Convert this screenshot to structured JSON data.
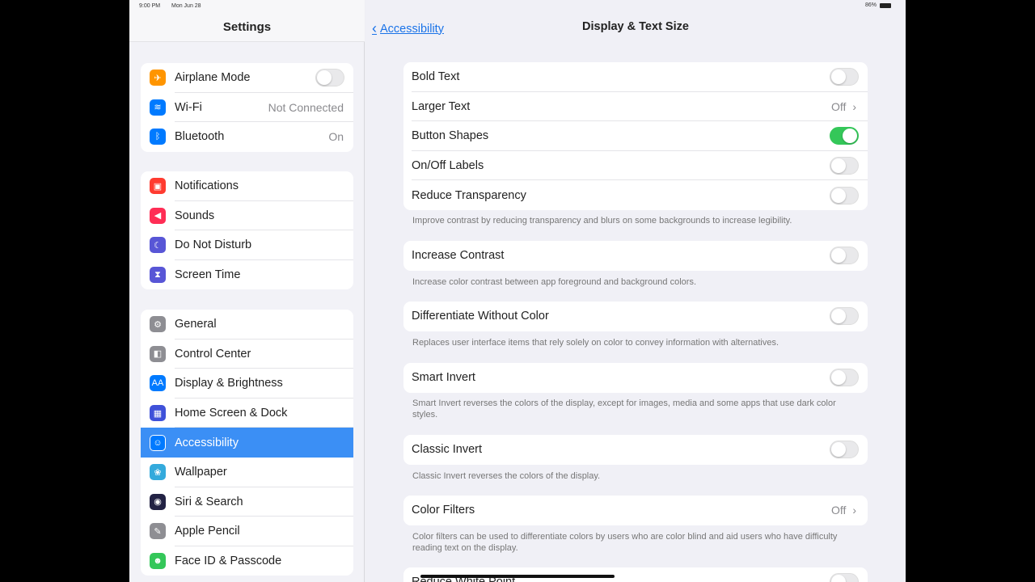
{
  "status": {
    "time": "9:00 PM",
    "date": "Mon Jun 28",
    "battery": "86%"
  },
  "sidebar": {
    "title": "Settings",
    "groups": [
      [
        {
          "label": "Airplane Mode",
          "icon": "airplane-icon",
          "color": "#ff9500",
          "toggle": false
        },
        {
          "label": "Wi-Fi",
          "icon": "wifi-icon",
          "color": "#007aff",
          "value": "Not Connected"
        },
        {
          "label": "Bluetooth",
          "icon": "bluetooth-icon",
          "color": "#007aff",
          "value": "On"
        }
      ],
      [
        {
          "label": "Notifications",
          "icon": "notifications-icon",
          "color": "#ff3b30"
        },
        {
          "label": "Sounds",
          "icon": "sounds-icon",
          "color": "#ff2d55"
        },
        {
          "label": "Do Not Disturb",
          "icon": "moon-icon",
          "color": "#5856d6"
        },
        {
          "label": "Screen Time",
          "icon": "hourglass-icon",
          "color": "#5856d6"
        }
      ],
      [
        {
          "label": "General",
          "icon": "gear-icon",
          "color": "#8e8e93"
        },
        {
          "label": "Control Center",
          "icon": "control-center-icon",
          "color": "#8e8e93"
        },
        {
          "label": "Display & Brightness",
          "icon": "display-icon",
          "color": "#007aff"
        },
        {
          "label": "Home Screen & Dock",
          "icon": "home-screen-icon",
          "color": "#3f51d9"
        },
        {
          "label": "Accessibility",
          "icon": "accessibility-icon",
          "color": "#007aff",
          "selected": true
        },
        {
          "label": "Wallpaper",
          "icon": "wallpaper-icon",
          "color": "#34aadc"
        },
        {
          "label": "Siri & Search",
          "icon": "siri-icon",
          "color": "#222244"
        },
        {
          "label": "Apple Pencil",
          "icon": "pencil-icon",
          "color": "#8e8e93"
        },
        {
          "label": "Face ID & Passcode",
          "icon": "face-id-icon",
          "color": "#34c759"
        }
      ]
    ]
  },
  "detail": {
    "back_label": "Accessibility",
    "title": "Display & Text Size",
    "sections": [
      {
        "rows": [
          {
            "label": "Bold Text",
            "toggle": false
          },
          {
            "label": "Larger Text",
            "value": "Off"
          },
          {
            "label": "Button Shapes",
            "toggle": true
          },
          {
            "label": "On/Off Labels",
            "toggle": false
          },
          {
            "label": "Reduce Transparency",
            "toggle": false
          }
        ],
        "footer": "Improve contrast by reducing transparency and blurs on some backgrounds to increase legibility."
      },
      {
        "rows": [
          {
            "label": "Increase Contrast",
            "toggle": false
          }
        ],
        "footer": "Increase color contrast between app foreground and background colors."
      },
      {
        "rows": [
          {
            "label": "Differentiate Without Color",
            "toggle": false
          }
        ],
        "footer": "Replaces user interface items that rely solely on color to convey information with alternatives."
      },
      {
        "rows": [
          {
            "label": "Smart Invert",
            "toggle": false
          }
        ],
        "footer": "Smart Invert reverses the colors of the display, except for images, media and some apps that use dark color styles."
      },
      {
        "rows": [
          {
            "label": "Classic Invert",
            "toggle": false
          }
        ],
        "footer": "Classic Invert reverses the colors of the display."
      },
      {
        "rows": [
          {
            "label": "Color Filters",
            "value": "Off"
          }
        ],
        "footer": "Color filters can be used to differentiate colors by users who are color blind and aid users who have difficulty reading text on the display."
      },
      {
        "rows": [
          {
            "label": "Reduce White Point",
            "toggle": false
          }
        ]
      }
    ]
  }
}
